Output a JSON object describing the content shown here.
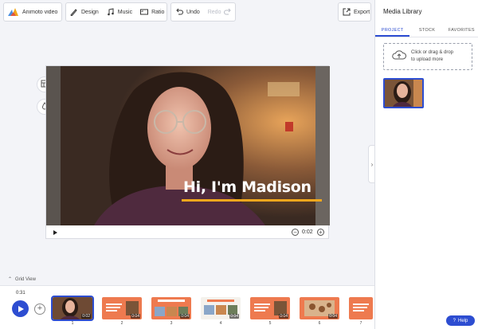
{
  "toolbar": {
    "project_name": "Animoto video",
    "design_label": "Design",
    "music_label": "Music",
    "ratio_label": "Ratio",
    "undo_label": "Undo",
    "redo_label": "Redo",
    "export_label": "Export"
  },
  "video": {
    "caption": "Hi, I'm Madison",
    "current_time": "0:02"
  },
  "timeline": {
    "grid_view_label": "Grid View",
    "total_time": "0:31",
    "clips": [
      {
        "num": "1",
        "dur": "0:02",
        "kind": "photo"
      },
      {
        "num": "2",
        "dur": "0:04",
        "kind": "title"
      },
      {
        "num": "3",
        "dur": "0:04",
        "kind": "collage"
      },
      {
        "num": "4",
        "dur": "0:04",
        "kind": "banner"
      },
      {
        "num": "5",
        "dur": "0:04",
        "kind": "title2"
      },
      {
        "num": "6",
        "dur": "0:04",
        "kind": "food"
      },
      {
        "num": "7",
        "dur": "",
        "kind": "partial"
      }
    ]
  },
  "panel": {
    "title": "Media Library",
    "tabs": [
      "PROJECT",
      "STOCK",
      "FAVORITES"
    ],
    "upload_line1": "Click or drag & drop",
    "upload_line2": "to upload more"
  },
  "help_label": "Help",
  "colors": {
    "accent": "#2d4dd1",
    "caption_underline": "#f2a71d",
    "clip_orange": "#ee7a4f"
  }
}
